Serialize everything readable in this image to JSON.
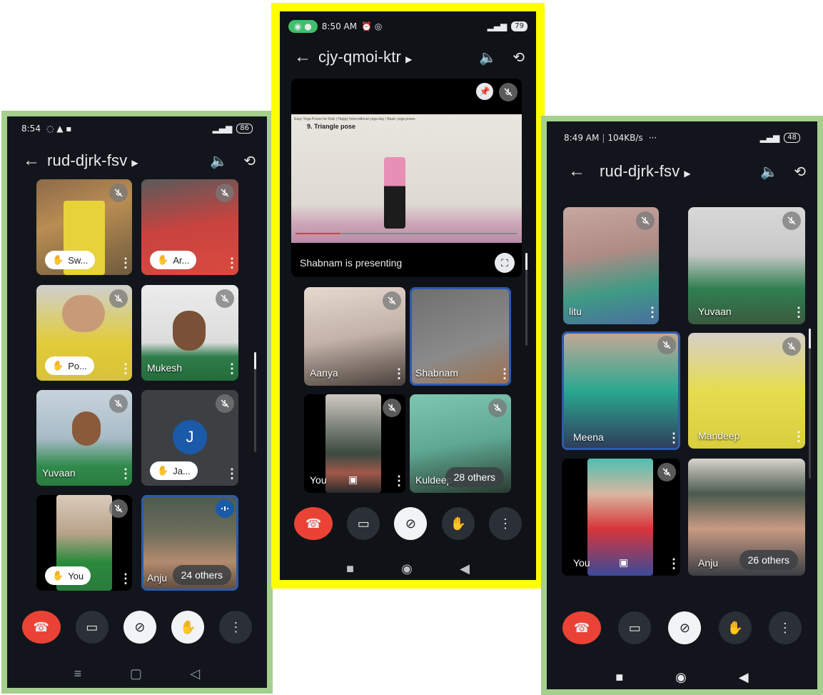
{
  "left": {
    "status_time": "8:54",
    "status_battery": "86",
    "meeting_code": "rud-djrk-fsv",
    "tiles": [
      {
        "label": "Sw...",
        "kind": "pill",
        "muted": true
      },
      {
        "label": "Ar...",
        "kind": "pill",
        "muted": true
      },
      {
        "label": "Po...",
        "kind": "pill",
        "muted": true
      },
      {
        "label": "Mukesh",
        "kind": "name",
        "muted": true
      },
      {
        "label": "Yuvaan",
        "kind": "name",
        "muted": true
      },
      {
        "label": "Ja...",
        "kind": "pill",
        "muted": true,
        "avatar": "J"
      },
      {
        "label": "You",
        "kind": "pill",
        "muted": true
      },
      {
        "label": "Anju",
        "kind": "name",
        "others": "24 others"
      }
    ]
  },
  "center": {
    "status_time": "8:50 AM",
    "status_battery": "79",
    "meeting_code": "cjy-qmoi-ktr",
    "video_title": "Easy Yoga Poses for Kids | Happy International yoga day | Basic yoga poses",
    "video_caption": "9. Triangle pose",
    "presenting_text": "Shabnam is presenting",
    "tiles": [
      {
        "label": "Aanya",
        "muted": true
      },
      {
        "label": "Shabnam",
        "muted": false
      },
      {
        "label": "You",
        "muted": true
      },
      {
        "label": "Kuldeep",
        "others": "28 others",
        "muted": true
      }
    ]
  },
  "right": {
    "status_time": "8:49 AM",
    "status_speed": "104KB/s",
    "status_battery": "48",
    "meeting_code": "rud-djrk-fsv",
    "tiles": [
      {
        "label": "litu",
        "muted": true
      },
      {
        "label": "Yuvaan",
        "muted": true
      },
      {
        "label": "Meena",
        "muted": true
      },
      {
        "label": "Mandeep",
        "muted": true
      },
      {
        "label": "You",
        "muted": true
      },
      {
        "label": "Anju",
        "others": "26 others"
      }
    ]
  },
  "colors": {
    "left_frame": "#a4cf8c",
    "center_frame": "#ffff00",
    "right_frame": "#a4cf8c",
    "end_call": "#ea4335"
  }
}
